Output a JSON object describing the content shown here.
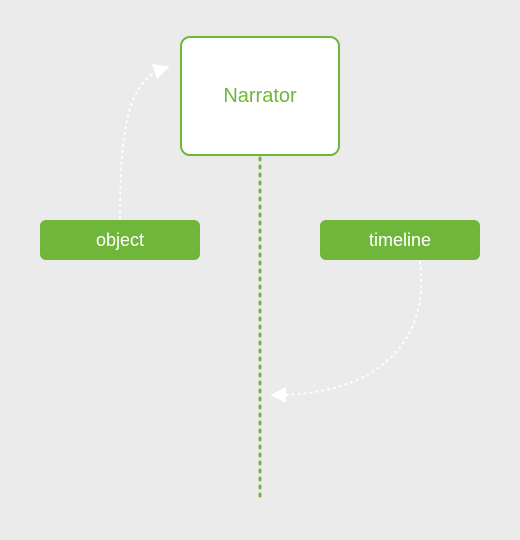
{
  "nodes": {
    "narrator": "Narrator",
    "object": "object",
    "timeline": "timeline"
  },
  "colors": {
    "accent": "#70b63a",
    "node_bg": "#ffffff",
    "pill_text": "#ffffff",
    "canvas": "#ebebeb",
    "connector": "#ffffff"
  }
}
